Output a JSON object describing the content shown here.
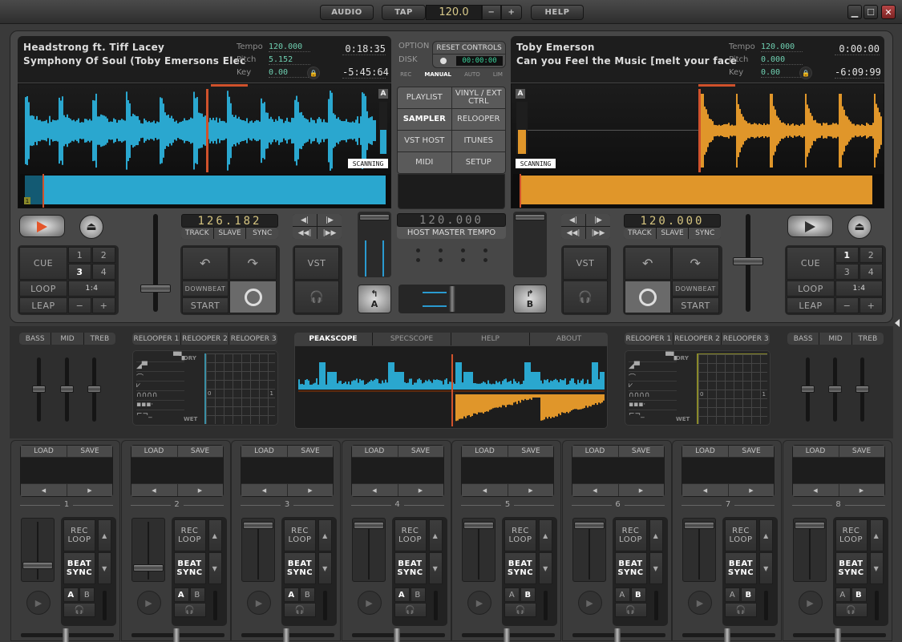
{
  "topbar": {
    "audio_label": "AUDIO",
    "tap_label": "TAP",
    "bpm_value": "120.0",
    "minus_label": "−",
    "plus_label": "+",
    "help_label": "HELP",
    "window_controls": {
      "minimize": "▁",
      "maximize": "☐",
      "close": "✕"
    }
  },
  "deck_a": {
    "artist": "Headstrong ft. Tiff Lacey",
    "title": "Symphony Of Soul (Toby Emersons Elec",
    "tempo_label": "Tempo",
    "tempo_value": "120.000",
    "pitch_label": "Pitch",
    "pitch_value": "5.152",
    "key_label": "Key",
    "key_value": "0.00",
    "elapsed": "0:18:35",
    "remaining": "-5:45:64",
    "scanning_label": "SCANNING",
    "channel_badge": "A",
    "cue_marker": "1",
    "bpm_display": "126.182",
    "track_label": "TRACK",
    "slave_label": "SLAVE",
    "sync_label": "SYNC",
    "cue_label": "CUE",
    "loop_label": "LOOP",
    "leap_label": "LEAP",
    "hotcues": [
      "1",
      "2",
      "3",
      "4"
    ],
    "loop_size": "1:4",
    "leap_minus": "−",
    "leap_plus": "+",
    "downbeat_label": "DOWNBEAT",
    "start_label": "START",
    "vst_label": "VST",
    "playing": true
  },
  "deck_b": {
    "artist": "Toby Emerson",
    "title": "Can you Feel the Music [melt your face",
    "tempo_label": "Tempo",
    "tempo_value": "120.000",
    "pitch_label": "Pitch",
    "pitch_value": "0.000",
    "key_label": "Key",
    "key_value": "0.00",
    "elapsed": "0:00:00",
    "remaining": "-6:09:99",
    "scanning_label": "SCANNING",
    "channel_badge": "A",
    "bpm_display": "120.000",
    "track_label": "TRACK",
    "slave_label": "SLAVE",
    "sync_label": "SYNC",
    "cue_label": "CUE",
    "loop_label": "LOOP",
    "leap_label": "LEAP",
    "hotcues": [
      "1",
      "2",
      "3",
      "4"
    ],
    "loop_size": "1:4",
    "leap_minus": "−",
    "leap_plus": "+",
    "downbeat_label": "DOWNBEAT",
    "start_label": "START",
    "vst_label": "VST",
    "playing": false
  },
  "center": {
    "option_label": "OPTION",
    "disk_label": "DISK",
    "reset_label": "RESET CONTROLS",
    "disk_time": "00:00:00",
    "rec_modes": [
      "REC",
      "MANUAL",
      "AUTO",
      "LIM"
    ],
    "rec_mode_active": "MANUAL",
    "nav": [
      {
        "label": "PLAYLIST",
        "active": false
      },
      {
        "label": "VINYL / EXT CTRL",
        "active": false
      },
      {
        "label": "SAMPLER",
        "active": true
      },
      {
        "label": "RELOOPER",
        "active": false
      },
      {
        "label": "VST HOST",
        "active": false
      },
      {
        "label": "ITUNES",
        "active": false
      },
      {
        "label": "MIDI",
        "active": false
      },
      {
        "label": "SETUP",
        "active": false
      }
    ],
    "host_tempo": "120.000",
    "host_tempo_label": "HOST MASTER TEMPO",
    "fx_a_label": "A",
    "fx_b_label": "B"
  },
  "eq": {
    "labels": [
      "BASS",
      "MID",
      "TREB"
    ]
  },
  "relooper": {
    "tabs": [
      "RELOOPER 1",
      "RELOOPER 2",
      "RELOOPER 3"
    ],
    "dry_label": "DRY",
    "wet_label": "WET",
    "x_min": "0",
    "x_max": "1",
    "filter_types": [
      "lowpass",
      "highpass",
      "bandpass",
      "notch",
      "comb",
      "bitcrush",
      "stepped"
    ]
  },
  "scope": {
    "tabs": [
      "PEAKSCOPE",
      "SPECSCOPE",
      "HELP",
      "ABOUT"
    ],
    "active_tab": "PEAKSCOPE"
  },
  "samplers": [
    {
      "n": "1",
      "a_active": true,
      "b_active": false,
      "level": 0.25
    },
    {
      "n": "2",
      "a_active": true,
      "b_active": false,
      "level": 0.2
    },
    {
      "n": "3",
      "a_active": true,
      "b_active": false,
      "level": 1.0
    },
    {
      "n": "4",
      "a_active": true,
      "b_active": false,
      "level": 1.0
    },
    {
      "n": "5",
      "a_active": false,
      "b_active": true,
      "level": 1.0
    },
    {
      "n": "6",
      "a_active": false,
      "b_active": true,
      "level": 1.0
    },
    {
      "n": "7",
      "a_active": false,
      "b_active": true,
      "level": 1.0
    },
    {
      "n": "8",
      "a_active": false,
      "b_active": true,
      "level": 1.0
    }
  ],
  "sampler_labels": {
    "load": "LOAD",
    "save": "SAVE",
    "rec_loop": "REC LOOP",
    "beat_sync": "BEAT SYNC",
    "a": "A",
    "b": "B",
    "prev": "◀",
    "next": "▶",
    "up": "▲",
    "down": "▼"
  },
  "colors": {
    "deck_a": "#2aa7cf",
    "deck_b": "#e0962a",
    "playhead": "#d0522c"
  }
}
